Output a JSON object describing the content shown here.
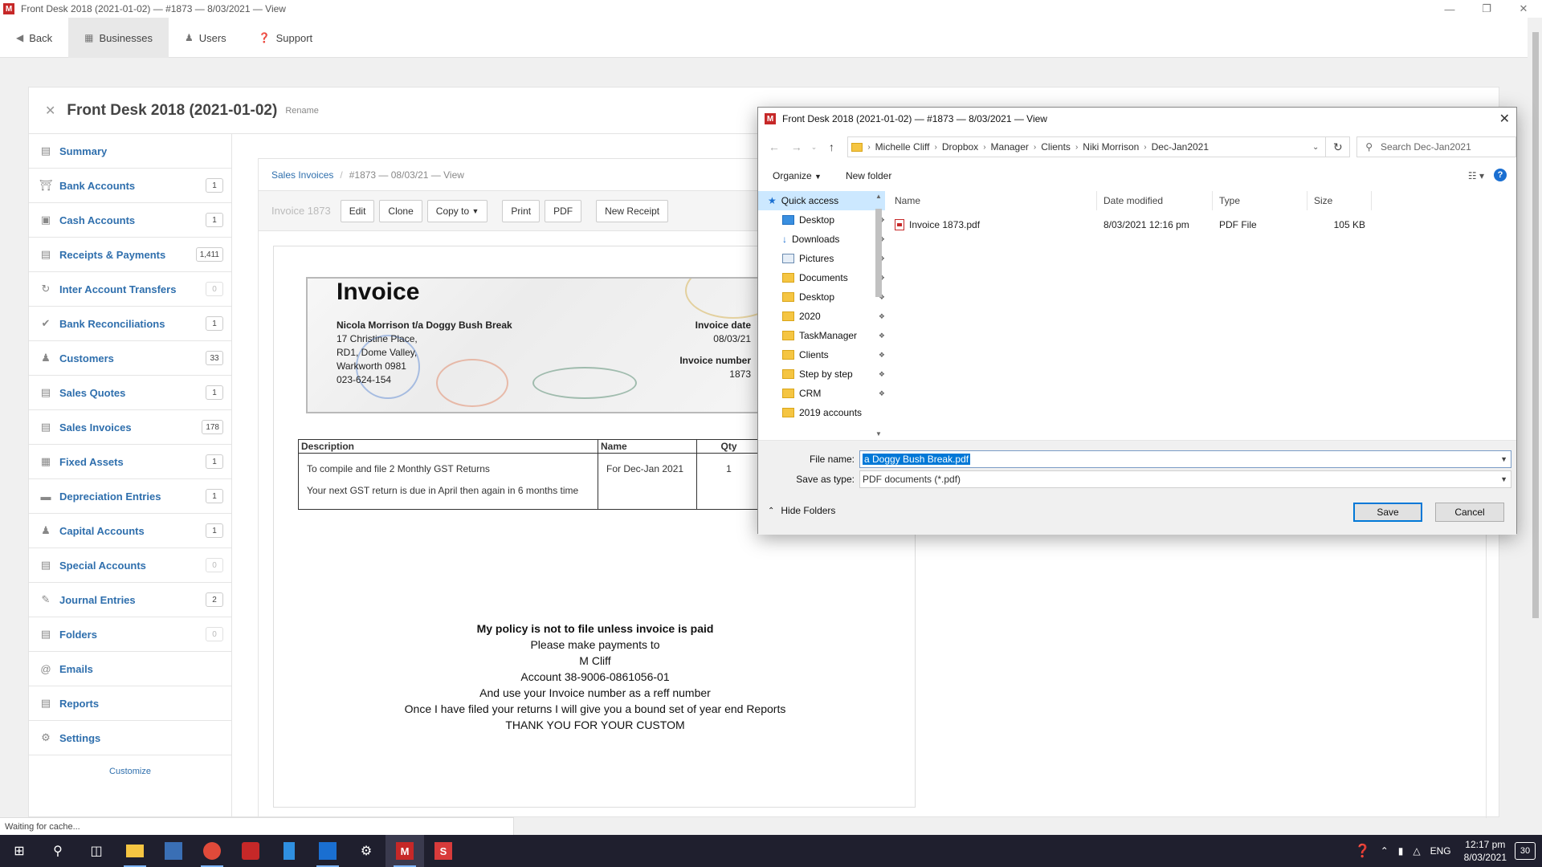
{
  "window": {
    "title": "Front Desk 2018 (2021-01-02) — #1873 — 8/03/2021 — View",
    "app_logo": "M"
  },
  "topnav": {
    "back": "Back",
    "businesses": "Businesses",
    "users": "Users",
    "support": "Support"
  },
  "business": {
    "title": "Front Desk 2018 (2021-01-02)",
    "rename": "Rename"
  },
  "sidebar": {
    "items": [
      {
        "label": "Summary",
        "count": "",
        "icon": "summary-icon"
      },
      {
        "label": "Bank Accounts",
        "count": "1",
        "icon": "bank-icon"
      },
      {
        "label": "Cash Accounts",
        "count": "1",
        "icon": "cash-icon"
      },
      {
        "label": "Receipts & Payments",
        "count": "1,411",
        "icon": "receipts-icon"
      },
      {
        "label": "Inter Account Transfers",
        "count": "0",
        "icon": "transfer-icon"
      },
      {
        "label": "Bank Reconciliations",
        "count": "1",
        "icon": "check-icon"
      },
      {
        "label": "Customers",
        "count": "33",
        "icon": "customers-icon"
      },
      {
        "label": "Sales Quotes",
        "count": "1",
        "icon": "quote-icon"
      },
      {
        "label": "Sales Invoices",
        "count": "178",
        "icon": "invoice-icon"
      },
      {
        "label": "Fixed Assets",
        "count": "1",
        "icon": "asset-icon"
      },
      {
        "label": "Depreciation Entries",
        "count": "1",
        "icon": "depreciation-icon"
      },
      {
        "label": "Capital Accounts",
        "count": "1",
        "icon": "capital-icon"
      },
      {
        "label": "Special Accounts",
        "count": "0",
        "icon": "special-icon"
      },
      {
        "label": "Journal Entries",
        "count": "2",
        "icon": "journal-icon"
      },
      {
        "label": "Folders",
        "count": "0",
        "icon": "folder-icon"
      },
      {
        "label": "Emails",
        "count": "",
        "icon": "email-icon"
      },
      {
        "label": "Reports",
        "count": "",
        "icon": "reports-icon"
      },
      {
        "label": "Settings",
        "count": "",
        "icon": "settings-icon"
      }
    ],
    "customize": "Customize"
  },
  "breadcrumb": {
    "parent": "Sales Invoices",
    "current": "#1873 — 08/03/21 — View"
  },
  "toolbar": {
    "invoice_label": "Invoice 1873",
    "edit": "Edit",
    "clone": "Clone",
    "copy_to": "Copy to",
    "print": "Print",
    "pdf": "PDF",
    "new_receipt": "New Receipt"
  },
  "invoice": {
    "title": "Invoice",
    "from_name": "Nicola Morrison t/a Doggy Bush Break",
    "address1": "17 Christine Place,",
    "address2": "RD1, Dome Valley,",
    "address3": "Warkworth 0981",
    "phone": "023-624-154",
    "date_label": "Invoice date",
    "date_value": "08/03/21",
    "number_label": "Invoice number",
    "number_value": "1873",
    "table": {
      "headers": [
        "Description",
        "Name",
        "Qty"
      ],
      "desc_line1": "To compile and file 2 Monthly GST Returns",
      "desc_line2": "Your next GST return is due in April then again in 6 months time",
      "name": "For Dec-Jan 2021",
      "qty": "1"
    },
    "policy_lines": [
      "My policy is not to file unless invoice is paid",
      "Please make payments to",
      "M Cliff",
      "Account 38-9006-0861056-01",
      "And use your Invoice number as a reff number",
      "Once I have filed your returns I will give you a bound set of year end Reports",
      "THANK YOU FOR YOUR CUSTOM"
    ]
  },
  "status": "Waiting for cache...",
  "dialog": {
    "title": "Front Desk 2018 (2021-01-02) — #1873 — 8/03/2021 — View",
    "path": [
      "Michelle Cliff",
      "Dropbox",
      "Manager",
      "Clients",
      "Niki Morrison",
      "Dec-Jan2021"
    ],
    "search_placeholder": "Search Dec-Jan2021",
    "organize": "Organize",
    "new_folder": "New folder",
    "nav": [
      {
        "label": "Quick access",
        "kind": "star",
        "pin": false
      },
      {
        "label": "Desktop",
        "kind": "blue",
        "pin": true
      },
      {
        "label": "Downloads",
        "kind": "download",
        "pin": true
      },
      {
        "label": "Pictures",
        "kind": "pic",
        "pin": true
      },
      {
        "label": "Documents",
        "kind": "folder",
        "pin": true
      },
      {
        "label": "Desktop",
        "kind": "folder",
        "pin": true
      },
      {
        "label": "2020",
        "kind": "folder",
        "pin": true
      },
      {
        "label": "TaskManager",
        "kind": "folder",
        "pin": true
      },
      {
        "label": "Clients",
        "kind": "folder",
        "pin": true
      },
      {
        "label": "Step by step",
        "kind": "folder",
        "pin": true
      },
      {
        "label": "CRM",
        "kind": "folder",
        "pin": true
      },
      {
        "label": "2019 accounts",
        "kind": "folder",
        "pin": false
      }
    ],
    "columns": [
      "Name",
      "Date modified",
      "Type",
      "Size"
    ],
    "files": [
      {
        "name": "Invoice 1873.pdf",
        "modified": "8/03/2021 12:16 pm",
        "type": "PDF File",
        "size": "105 KB"
      }
    ],
    "file_name_label": "File name:",
    "file_name_value": "a Doggy Bush Break.pdf",
    "save_type_label": "Save as type:",
    "save_type_value": "PDF documents (*.pdf)",
    "hide_folders": "Hide Folders",
    "save": "Save",
    "cancel": "Cancel"
  },
  "taskbar": {
    "language": "ENG",
    "time": "12:17 pm",
    "date": "8/03/2021",
    "notifications": "30"
  }
}
